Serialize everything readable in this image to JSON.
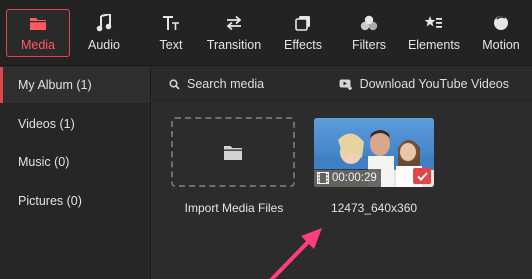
{
  "toolbar": {
    "tabs": [
      {
        "label": "Media",
        "icon": "folder-icon",
        "active": true
      },
      {
        "label": "Audio",
        "icon": "music-note-icon"
      },
      {
        "label": "Text",
        "icon": "text-icon"
      },
      {
        "label": "Transition",
        "icon": "transition-arrows-icon"
      },
      {
        "label": "Effects",
        "icon": "effects-icon"
      },
      {
        "label": "Filters",
        "icon": "filters-icon"
      },
      {
        "label": "Elements",
        "icon": "elements-icon"
      },
      {
        "label": "Motion",
        "icon": "motion-icon"
      }
    ]
  },
  "sidebar": {
    "items": [
      {
        "label": "My Album (1)",
        "active": true
      },
      {
        "label": "Videos (1)"
      },
      {
        "label": "Music (0)"
      },
      {
        "label": "Pictures (0)"
      }
    ]
  },
  "search": {
    "label": "Search media",
    "icon": "search-icon"
  },
  "download": {
    "label": "Download YouTube Videos",
    "icon": "youtube-download-icon"
  },
  "media": {
    "import_label": "Import Media Files",
    "clip": {
      "name": "12473_640x360",
      "duration": "00:00:29",
      "selected": true
    }
  },
  "colors": {
    "accent": "#e2464b",
    "annotation_arrow": "#ff3d7f"
  }
}
